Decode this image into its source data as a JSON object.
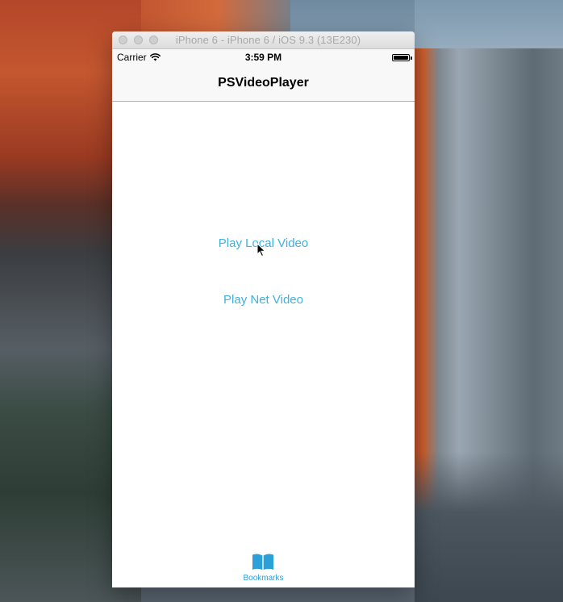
{
  "window": {
    "title": "iPhone 6 - iPhone 6 / iOS 9.3 (13E230)"
  },
  "status_bar": {
    "carrier": "Carrier",
    "time": "3:59 PM",
    "battery_level": 1.0
  },
  "nav_bar": {
    "title": "PSVideoPlayer"
  },
  "content": {
    "play_local_label": "Play Local Video",
    "play_net_label": "Play Net Video"
  },
  "tab_bar": {
    "items": [
      {
        "label": "Bookmarks",
        "icon": "bookmarks-icon",
        "selected": true
      }
    ]
  },
  "colors": {
    "link": "#3eb1de",
    "tab_active": "#2a9fd8"
  }
}
